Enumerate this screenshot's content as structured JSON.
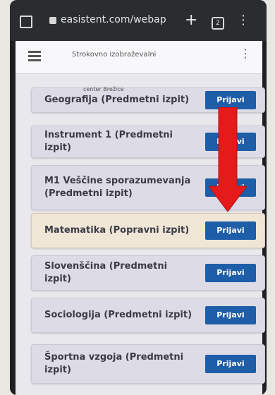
{
  "browser": {
    "url": "easistent.com/webap",
    "tab_count": "2"
  },
  "app": {
    "school_name": "Strokovno izobraževalni",
    "school_location": "center Brežice"
  },
  "exams": [
    {
      "title": "Geografija (Predmetni izpit)",
      "button": "Prijavi"
    },
    {
      "title": "Instrument 1 (Predmetni izpit)",
      "button": "Prijavi"
    },
    {
      "title": "M1 Veščine sporazumevanja (Predmetni izpit)",
      "button": "Prijavi"
    },
    {
      "title": "Matematika (Popravni izpit)",
      "button": "Prijavi"
    },
    {
      "title": "Slovenščina (Predmetni izpit)",
      "button": "Prijavi"
    },
    {
      "title": "Sociologija (Predmetni izpit)",
      "button": "Prijavi"
    },
    {
      "title": "Športna vzgoja (Predmetni izpit)",
      "button": "Prijavi"
    }
  ],
  "colors": {
    "button": "#1e5ea8",
    "arrow": "#e51b1b",
    "highlight": "#efe6d6"
  }
}
